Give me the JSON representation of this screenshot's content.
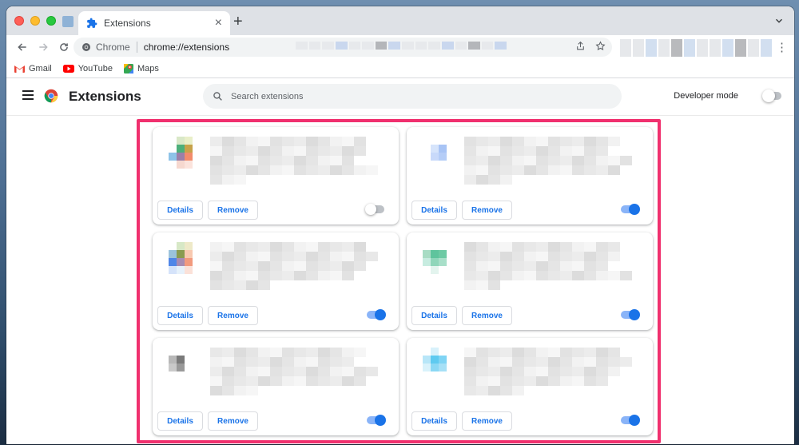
{
  "browser": {
    "tab_title": "Extensions",
    "tab_close": "×",
    "new_tab": "+",
    "omnibox_scheme_label": "Chrome",
    "omnibox_url": "chrome://extensions",
    "bookmarks": [
      {
        "label": "Gmail"
      },
      {
        "label": "YouTube"
      },
      {
        "label": "Maps"
      }
    ]
  },
  "extensions_page": {
    "title": "Extensions",
    "search_placeholder": "Search extensions",
    "developer_mode_label": "Developer mode",
    "developer_mode_on": false
  },
  "colors": {
    "accent": "#1a73e8",
    "highlight_border": "#f0306e",
    "toggle_track_on": "#8ab4f8"
  },
  "cards": [
    {
      "details_label": "Details",
      "remove_label": "Remove",
      "enabled": false
    },
    {
      "details_label": "Details",
      "remove_label": "Remove",
      "enabled": true
    },
    {
      "details_label": "Details",
      "remove_label": "Remove",
      "enabled": true
    },
    {
      "details_label": "Details",
      "remove_label": "Remove",
      "enabled": true
    },
    {
      "details_label": "Details",
      "remove_label": "Remove",
      "enabled": true
    },
    {
      "details_label": "Details",
      "remove_label": "Remove",
      "enabled": true
    }
  ]
}
